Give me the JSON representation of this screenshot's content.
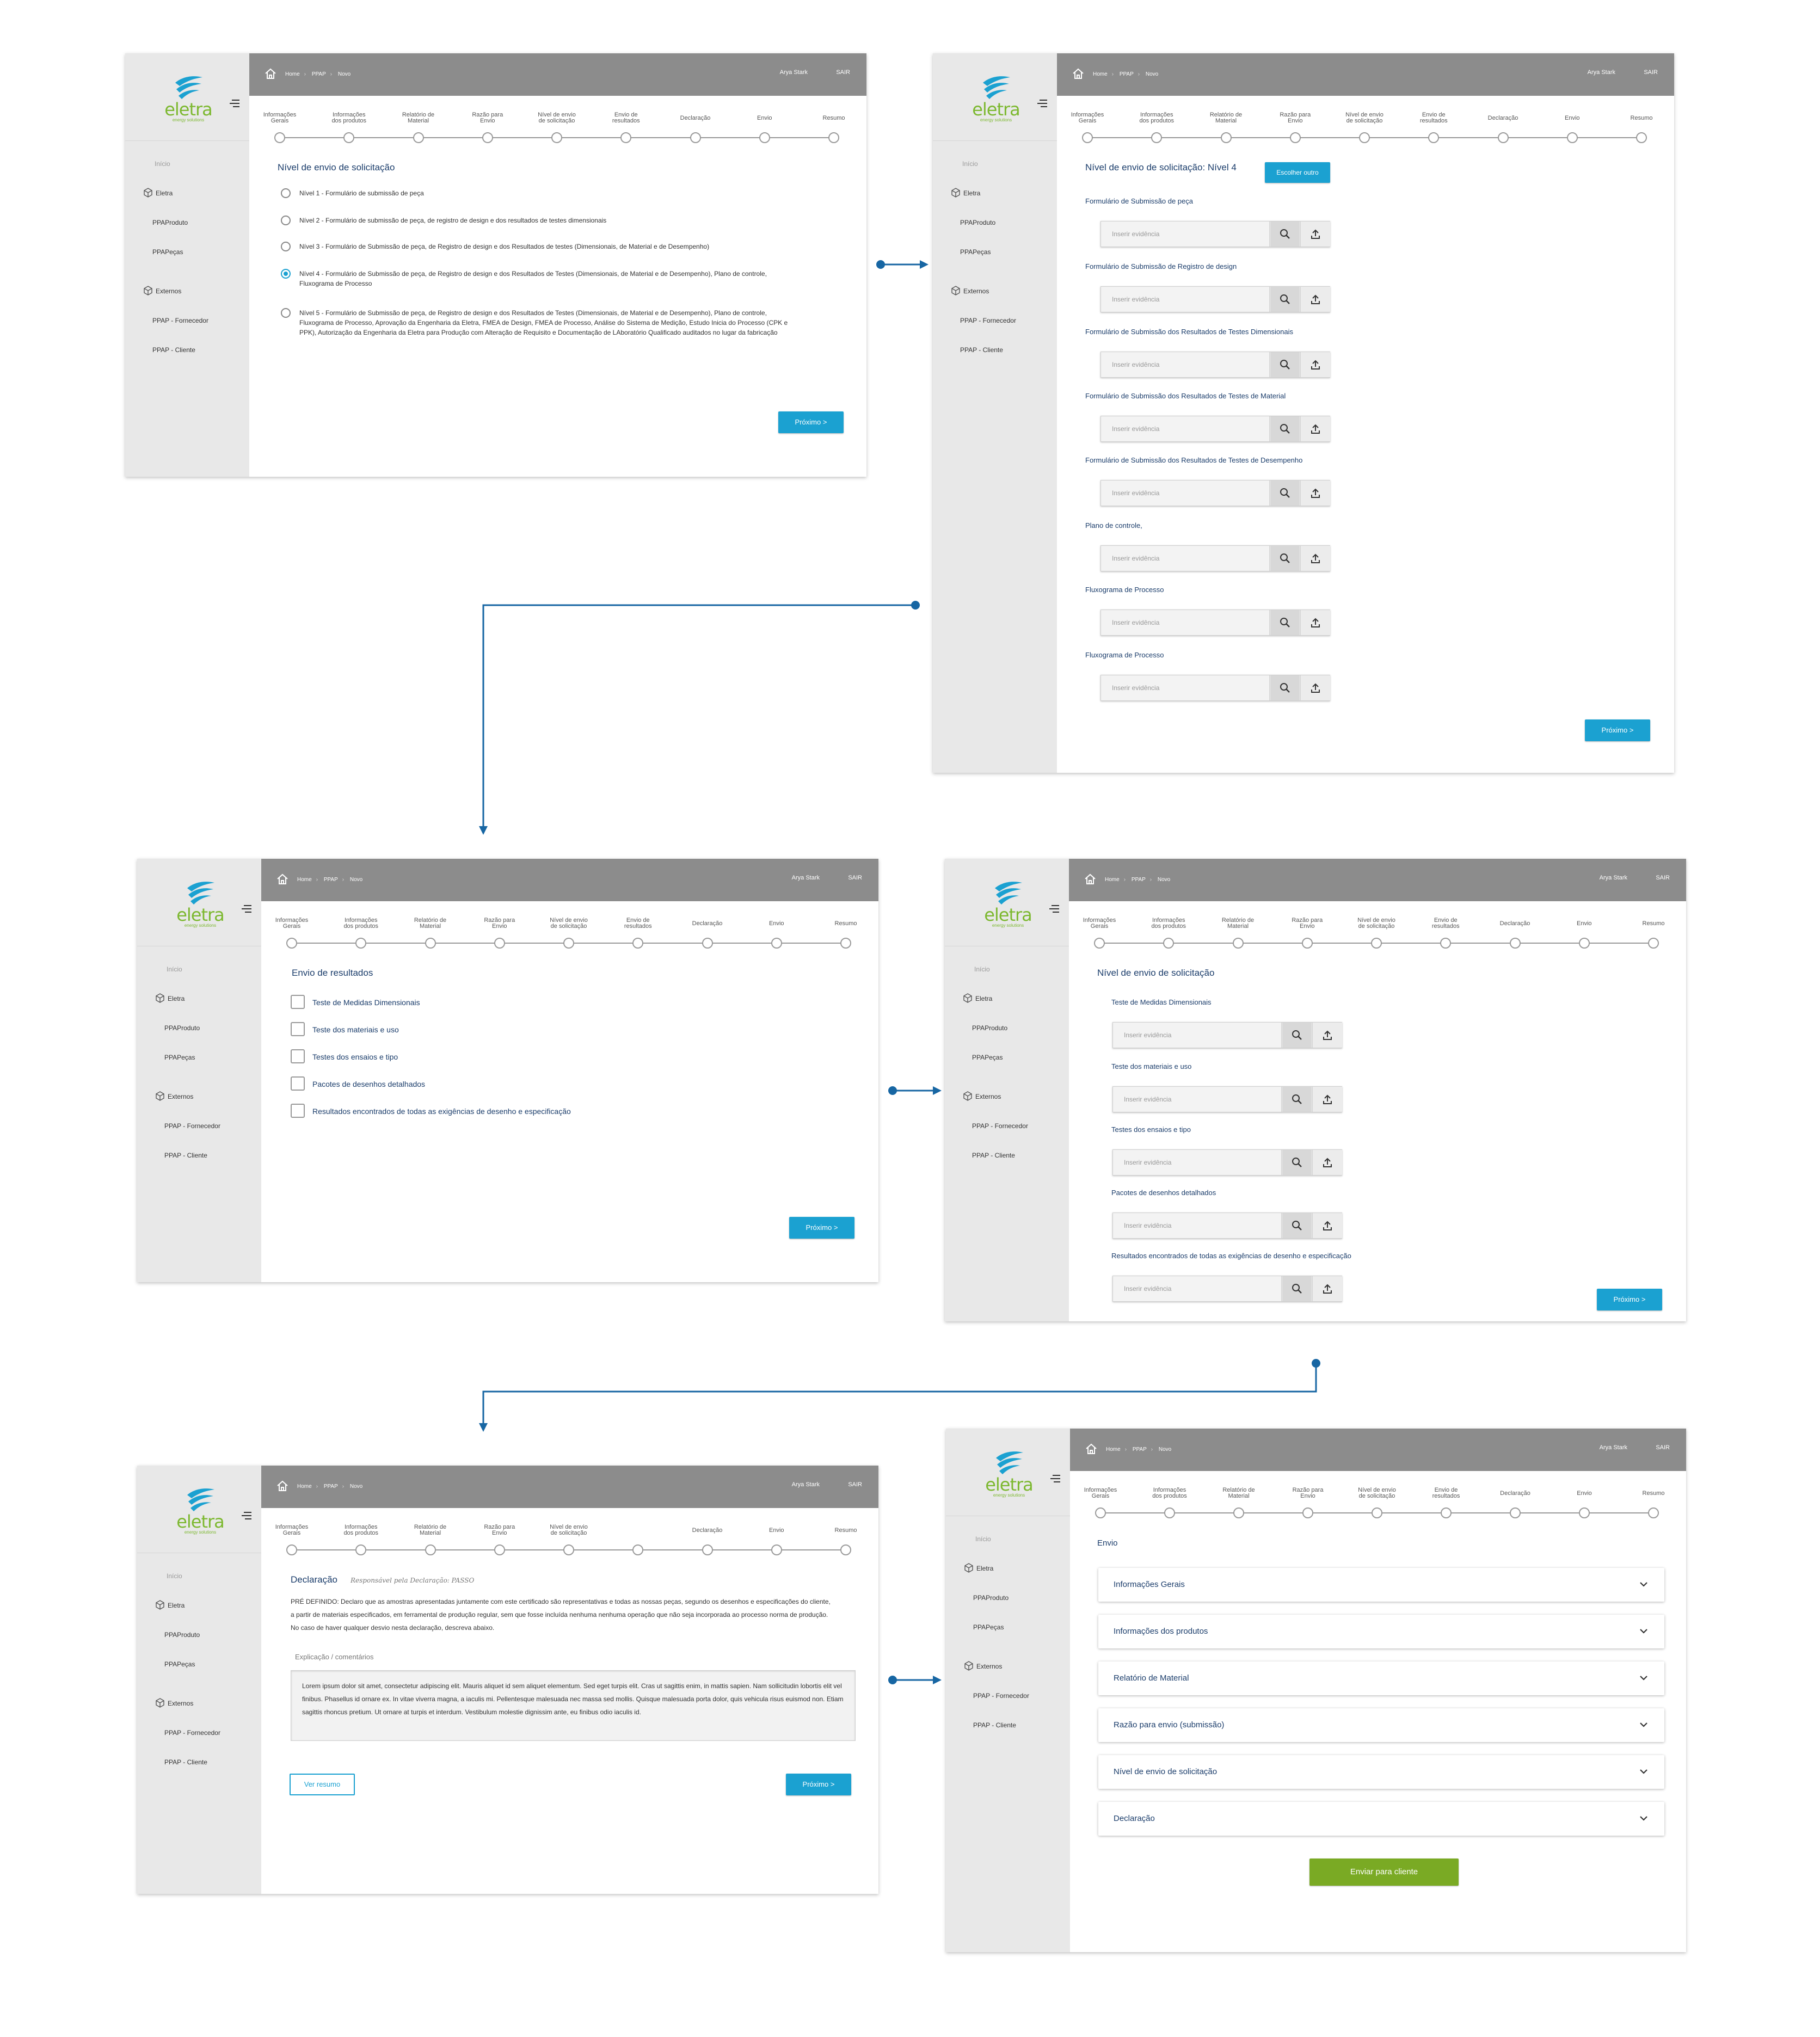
{
  "common": {
    "breadcrumb": [
      "Home",
      "PPAP",
      "Novo"
    ],
    "user_name": "Arya Stark",
    "logout": "SAIR",
    "logo_word": "eletra",
    "logo_tagline": "energy solutions",
    "sidebar": {
      "inicio": "Início",
      "eletra": "Eletra",
      "ppaproduto": "PPAProduto",
      "ppapecas": "PPAPeças",
      "externos": "Externos",
      "fornecedor": "PPAP - Fornecedor",
      "cliente": "PPAP - Cliente"
    },
    "steps": [
      [
        "Informações",
        "Gerais"
      ],
      [
        "Informações",
        "dos produtos"
      ],
      [
        "Relatório de",
        "Material"
      ],
      [
        "Razão para",
        "Envio"
      ],
      [
        "Nível de envio",
        "de solicitação"
      ],
      [
        "Envio de",
        "resultados"
      ],
      [
        "Declaração",
        ""
      ],
      [
        "Envio",
        ""
      ],
      [
        "Resumo",
        ""
      ]
    ],
    "next_button": "Próximo >",
    "evidence_placeholder": "Inserir evidência",
    "icons": [
      "home-icon",
      "menu-icon",
      "box-icon",
      "search-icon",
      "upload-icon",
      "chevron-down-icon",
      "eletra-wave-icon"
    ],
    "colors": {
      "accent": "#1ba1d1",
      "brand_green": "#7cb82f",
      "send_green": "#7aaa24",
      "topbar": "#8c8c8c",
      "sidebar": "#e8e8e8",
      "flow_arrow": "#1766a3"
    }
  },
  "screen1": {
    "title": "Nível de envio de solicitação",
    "options": [
      "Nível 1 - Formulário de submissão de peça",
      "Nível 2 - Formulário de submissão de peça, de registro de design e dos resultados de testes dimensionais",
      "Nível 3 - Formulário de Submissão de peça, de Registro de design e dos Resultados de testes (Dimensionais, de Material e de Desempenho)",
      "Nível 4 - Formulário de Submissão de peça, de Registro de design e dos Resultados de Testes (Dimensionais, de Material e de Desempenho), Plano de controle, Fluxograma de Processo",
      "Nível 5 - Formulário de Submissão de peça, de Registro de design e dos Resultados de Testes (Dimensionais, de Material e de Desempenho), Plano de controle, Fluxograma de Processo, Aprovação da Engenharia da Eletra, FMEA de Design, FMEA de Processo, Análise do Sistema de Medição, Estudo Inicia do Processo (CPK e PPK), Autorização da Engenharia da Eletra para Produção com Alteração de Requisito e Documentação de LAboratório Qualificado auditados no lugar da fabricação"
    ],
    "selected_option": 4
  },
  "screen2": {
    "title": "Nível de envio de solicitação: Nível 4",
    "choose_other": "Escolher outro",
    "fields": [
      "Formulário de Submissão de peça",
      "Formulário de Submissão de Registro de design",
      "Formulário de Submissão dos Resultados de Testes Dimensionais",
      "Formulário de Submissão dos Resultados de Testes de Material",
      "Formulário de Submissão dos Resultados de Testes de Desempenho",
      "Plano de controle,",
      "Fluxograma de Processo",
      "Fluxograma de Processo"
    ]
  },
  "screen3": {
    "title": "Envio de resultados",
    "checkboxes": [
      "Teste de Medidas Dimensionais",
      "Teste dos materiais e uso",
      "Testes dos ensaios e tipo",
      "Pacotes de desenhos detalhados",
      "Resultados encontrados de todas as exigências de desenho e especificação"
    ]
  },
  "screen4": {
    "title": "Nível de envio de solicitação",
    "fields": [
      "Teste de Medidas Dimensionais",
      "Teste dos materiais e uso",
      "Testes dos ensaios e tipo",
      "Pacotes de desenhos detalhados",
      "Resultados encontrados de todas as exigências de desenho e especificação"
    ]
  },
  "screen5": {
    "title": "Declaração",
    "signature": "Responsável pela Declaração: PASSO",
    "predefined": "PRÉ DEFINIDO: Declaro que as amostras apresentadas juntamente com este certificado são representativas e todas as nossas peças, segundo os desenhos e especificações do cliente, a partir de materiais especificados, em ferramental de produção regular, sem que fosse incluída nenhuma nenhuma operação que não seja incorporada ao processo norma de produção. No caso de haver qualquer desvio nesta declaração, descreva abaixo.",
    "comment_label": "Explicação / comentários",
    "comment_text": "Lorem ipsum dolor sit amet, consectetur adipiscing elit. Mauris aliquet id sem aliquet elementum. Sed eget turpis elit. Cras ut sagittis enim, in mattis sapien. Nam sollicitudin lobortis elit vel finibus. Phasellus id ornare ex. In vitae viverra magna, a iaculis mi. Pellentesque malesuada nec massa sed mollis. Quisque malesuada porta dolor, quis vehicula risus euismod non. Etiam sagittis rhoncus pretium. Ut ornare at turpis et interdum. Vestibulum molestie dignissim ante, eu finibus odio iaculis id.",
    "summary_button": "Ver resumo"
  },
  "screen6": {
    "title": "Envio",
    "sections": [
      "Informações Gerais",
      "Informações dos produtos",
      "Relatório de Material",
      "Razão para envio (submissão)",
      "Nível de envio de solicitação",
      "Declaração"
    ],
    "send_button": "Enviar para cliente"
  }
}
